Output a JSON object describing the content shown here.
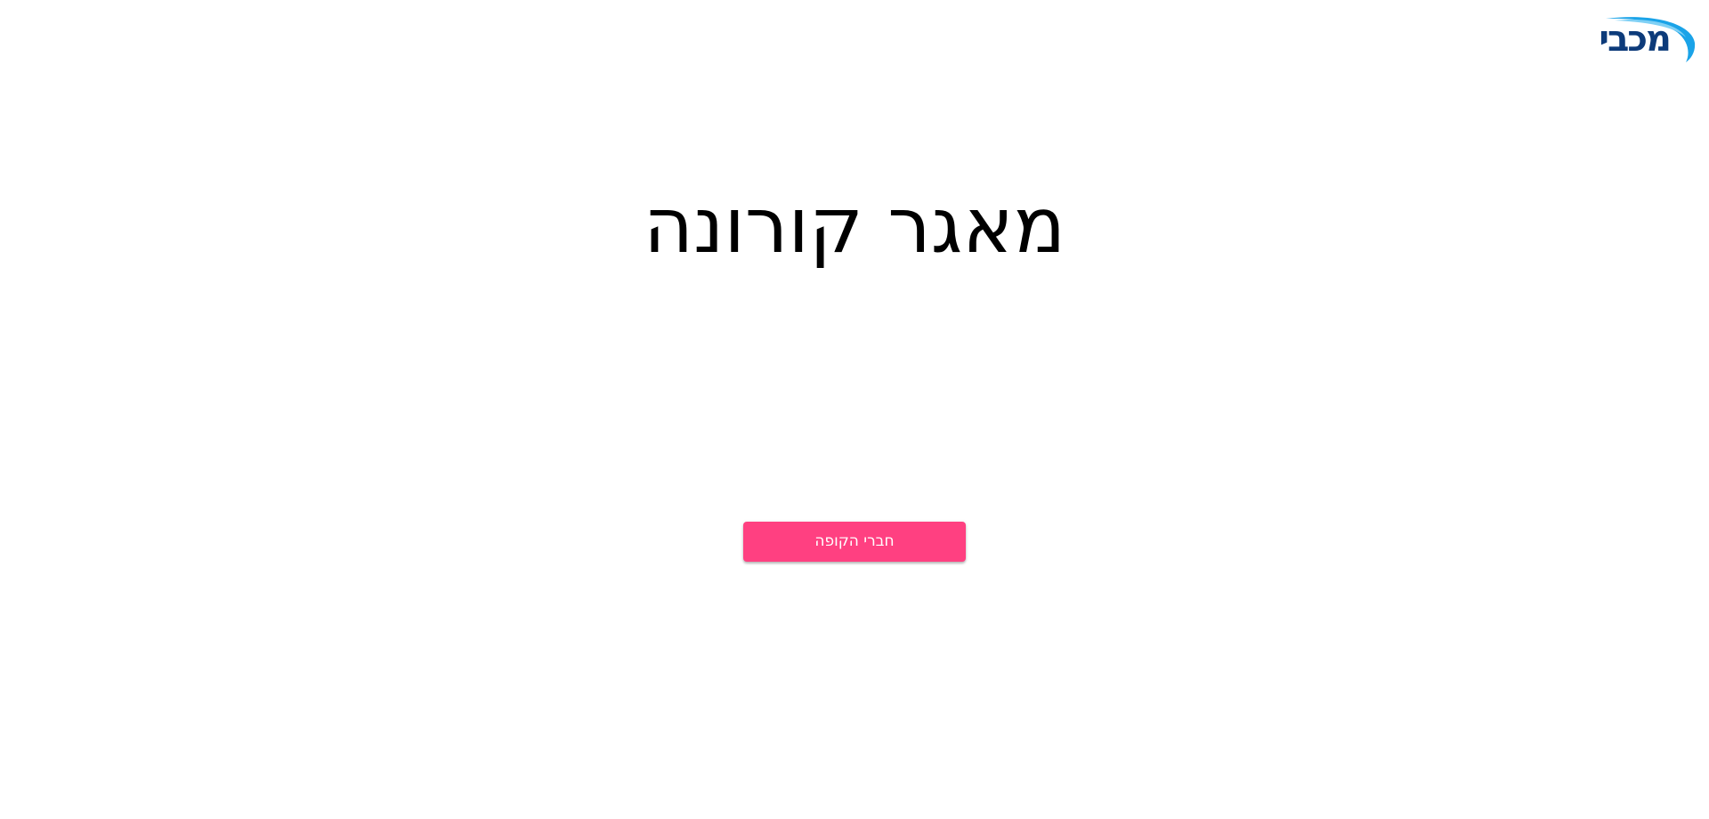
{
  "header": {
    "logo_text": "מכבי"
  },
  "main": {
    "title": "מאגר קורונה",
    "members_button_label": "חברי הקופה"
  },
  "colors": {
    "accent": "#ff4081",
    "brand_dark": "#0d3b7a",
    "brand_light": "#1aa3e8"
  }
}
